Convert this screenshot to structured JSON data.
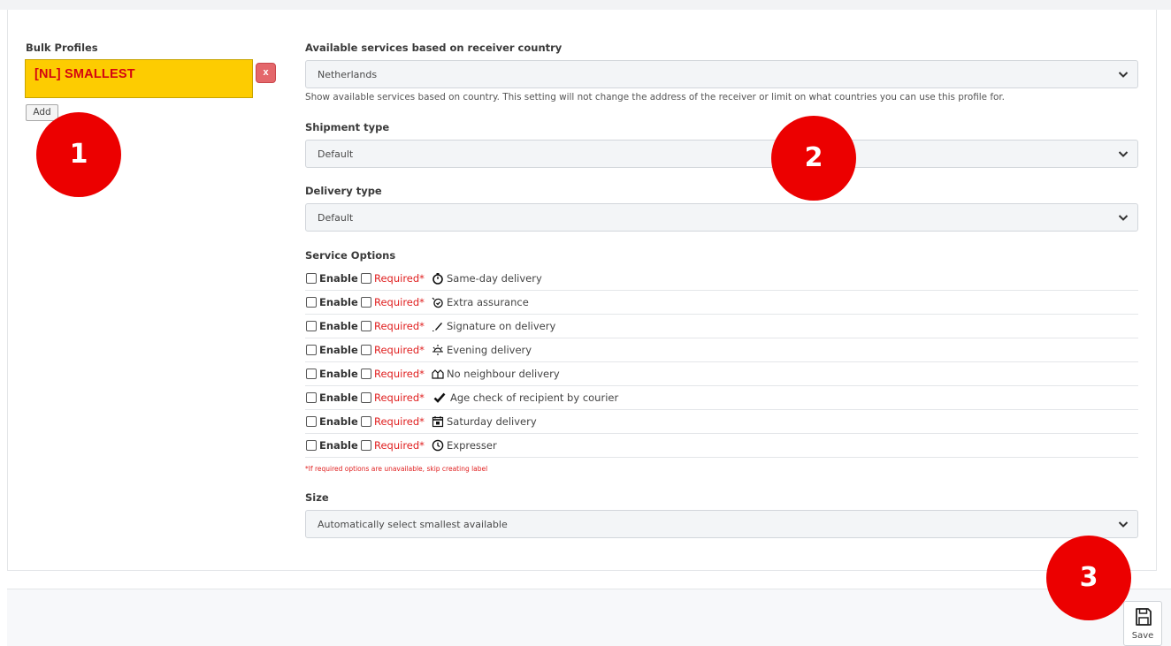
{
  "bulk_profiles": {
    "label": "Bulk Profiles",
    "selected_profile": "[NL] SMALLEST",
    "remove_label": "x",
    "add_label": "Add"
  },
  "country": {
    "label": "Available services based on receiver country",
    "value": "Netherlands",
    "hint": "Show available services based on country. This setting will not change the address of the receiver or limit on what countries you can use this profile for."
  },
  "shipment_type": {
    "label": "Shipment type",
    "value": "Default"
  },
  "delivery_type": {
    "label": "Delivery type",
    "value": "Default"
  },
  "service_options": {
    "label": "Service Options",
    "enable_label": "Enable",
    "required_label": "Required*",
    "items": [
      {
        "name": "Same-day delivery",
        "icon": "stopwatch-icon"
      },
      {
        "name": "Extra assurance",
        "icon": "assurance-icon"
      },
      {
        "name": "Signature on delivery",
        "icon": "pen-icon"
      },
      {
        "name": "Evening delivery",
        "icon": "sunset-icon"
      },
      {
        "name": "No neighbour delivery",
        "icon": "houses-icon"
      },
      {
        "name": "Age check of recipient by courier",
        "icon": "checkmark-icon"
      },
      {
        "name": "Saturday delivery",
        "icon": "calendar-icon"
      },
      {
        "name": "Expresser",
        "icon": "clock-icon"
      }
    ],
    "footnote": "*If required options are unavailable, skip creating label"
  },
  "size": {
    "label": "Size",
    "value": "Automatically select smallest available"
  },
  "badges": [
    "1",
    "2",
    "3"
  ],
  "save_label": "Save",
  "colors": {
    "profile_bg": "#fdcc01",
    "profile_text": "#d40511",
    "badge": "#ec0000",
    "required": "#e02020"
  }
}
